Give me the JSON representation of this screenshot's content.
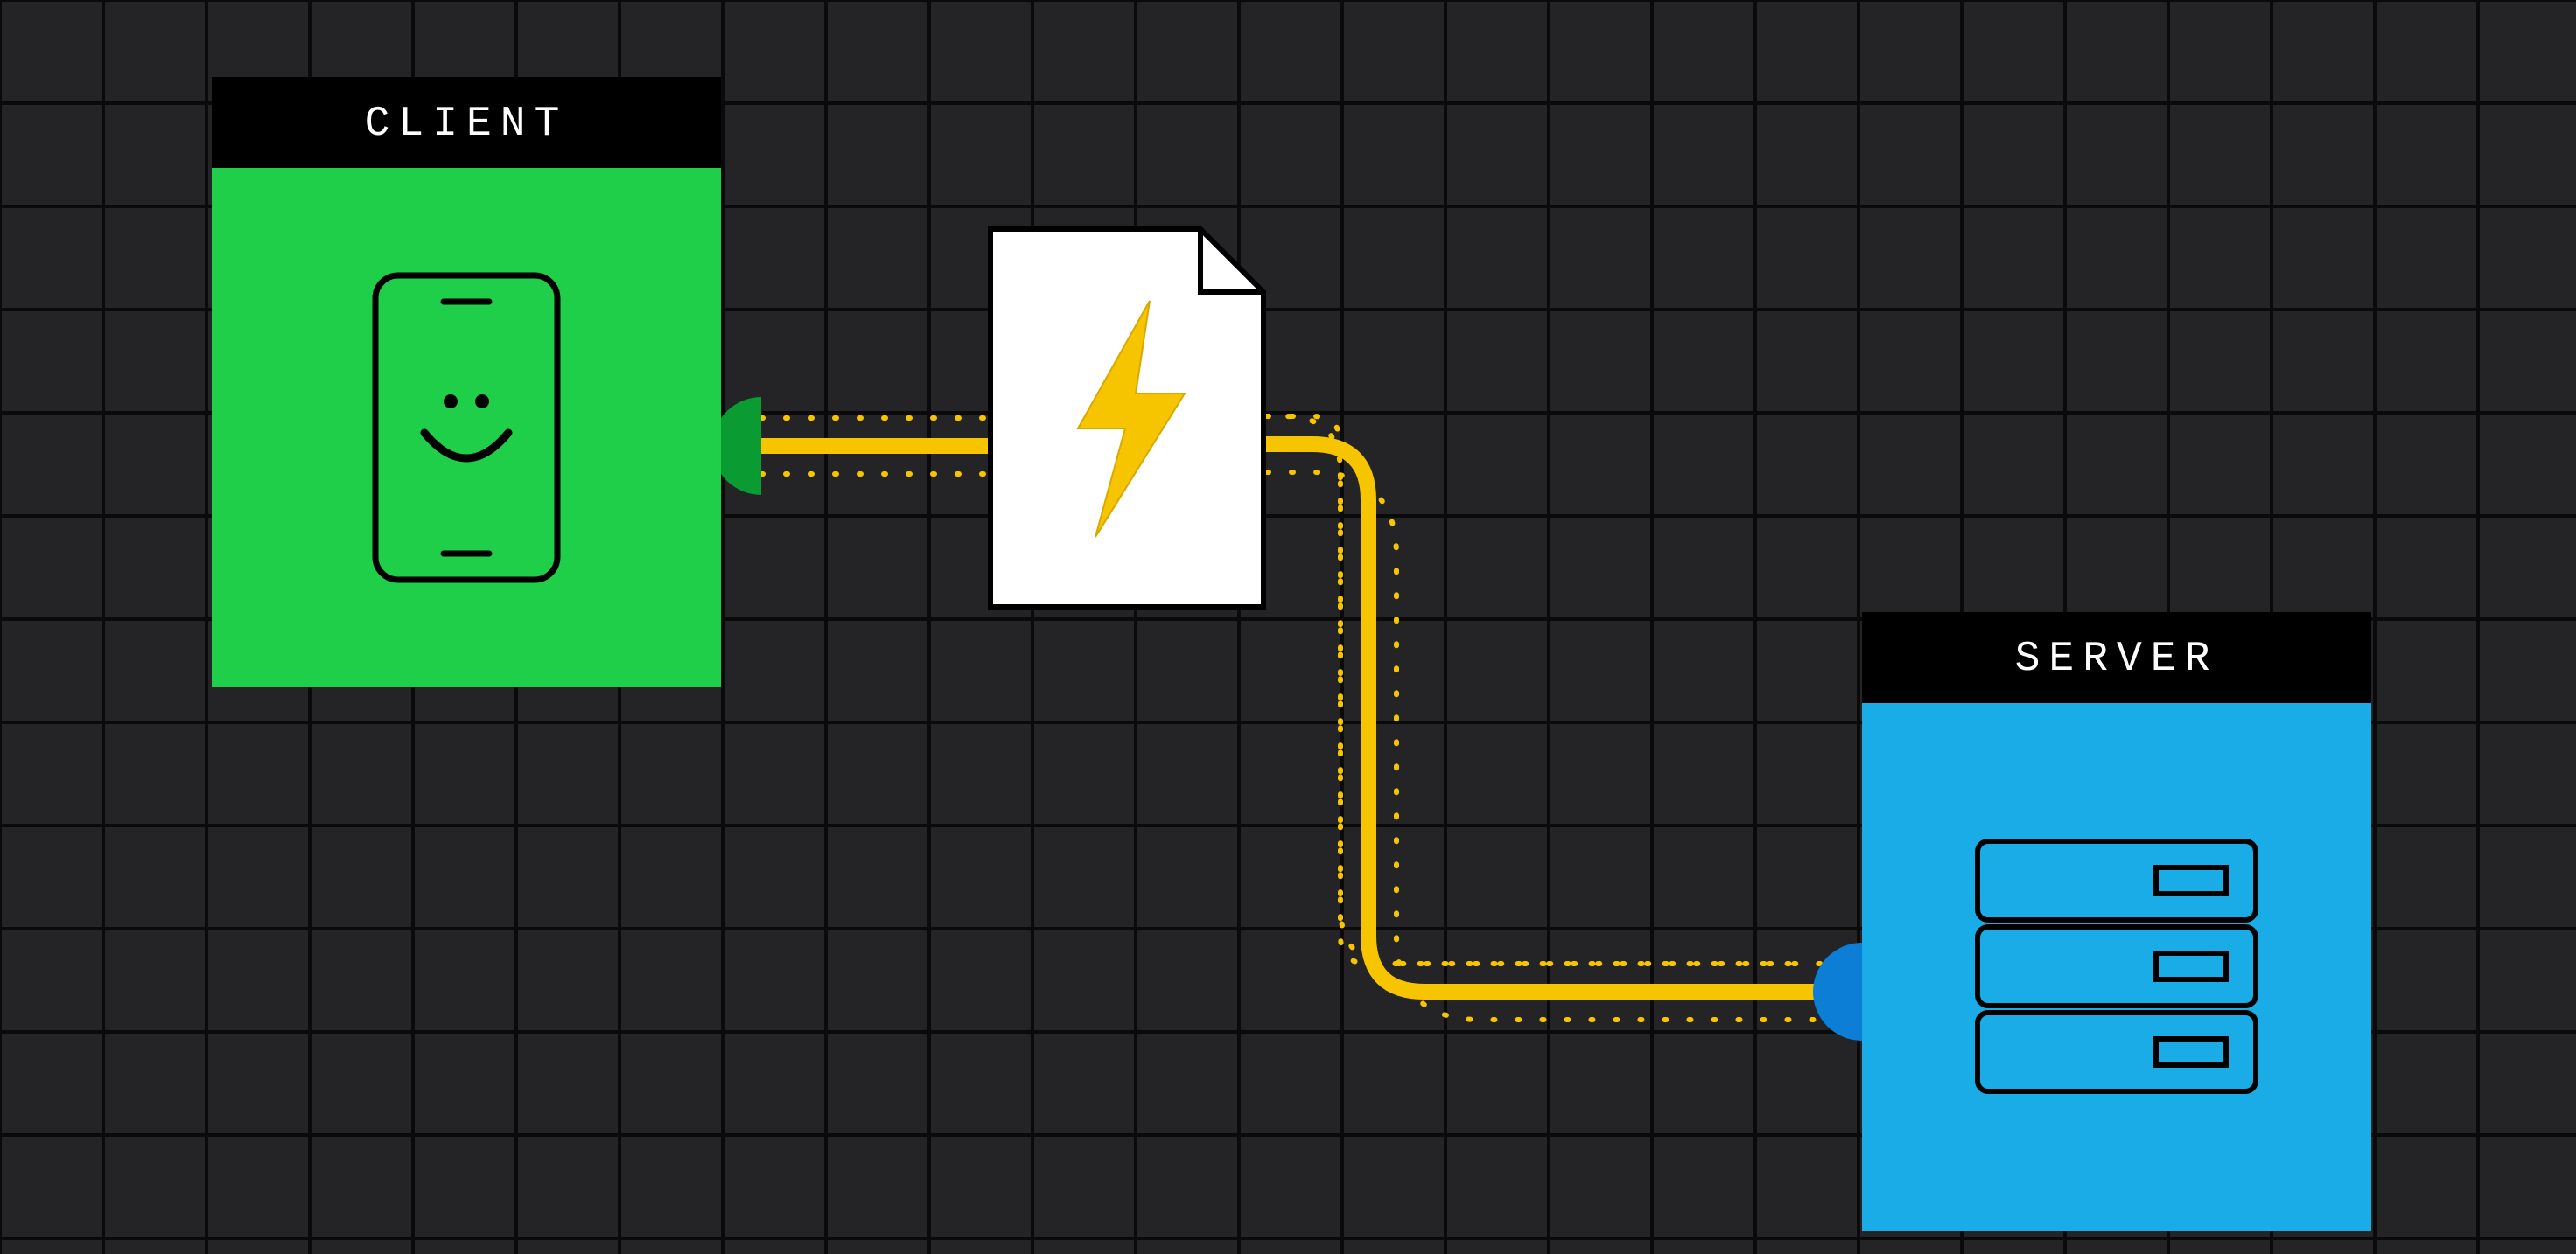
{
  "diagram": {
    "client_label": "CLIENT",
    "server_label": "SERVER",
    "payload": "lightning-document",
    "connection": "client-to-server",
    "colors": {
      "background": "#1e1e1e",
      "grid": "#000000",
      "grid_cell_tint": "#26262a",
      "client_fill": "#1fce49",
      "server_fill": "#19ace6",
      "wire": "#f6c500",
      "wire_dots": "#f6c500",
      "client_port": "#0a9b33",
      "server_port": "#0d7ed6",
      "header_bg": "#000000",
      "header_text": "#ffffff",
      "doc_bg": "#ffffff",
      "bolt": "#f6c500"
    }
  }
}
